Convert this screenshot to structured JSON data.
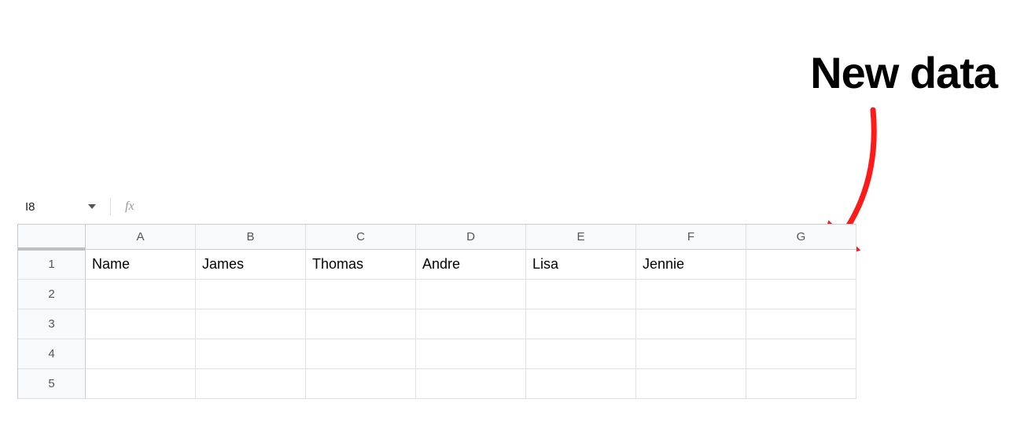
{
  "annotation": {
    "label": "New data"
  },
  "formula_bar": {
    "cell_ref": "I8",
    "fx_label": "fx",
    "formula": ""
  },
  "sheet": {
    "columns": [
      "A",
      "B",
      "C",
      "D",
      "E",
      "F",
      "G"
    ],
    "rows": [
      "1",
      "2",
      "3",
      "4",
      "5"
    ],
    "cells": {
      "r0": [
        "Name",
        "James",
        "Thomas",
        "Andre",
        "Lisa",
        "Jennie",
        ""
      ],
      "r1": [
        "",
        "",
        "",
        "",
        "",
        "",
        ""
      ],
      "r2": [
        "",
        "",
        "",
        "",
        "",
        "",
        ""
      ],
      "r3": [
        "",
        "",
        "",
        "",
        "",
        "",
        ""
      ],
      "r4": [
        "",
        "",
        "",
        "",
        "",
        "",
        ""
      ]
    }
  }
}
